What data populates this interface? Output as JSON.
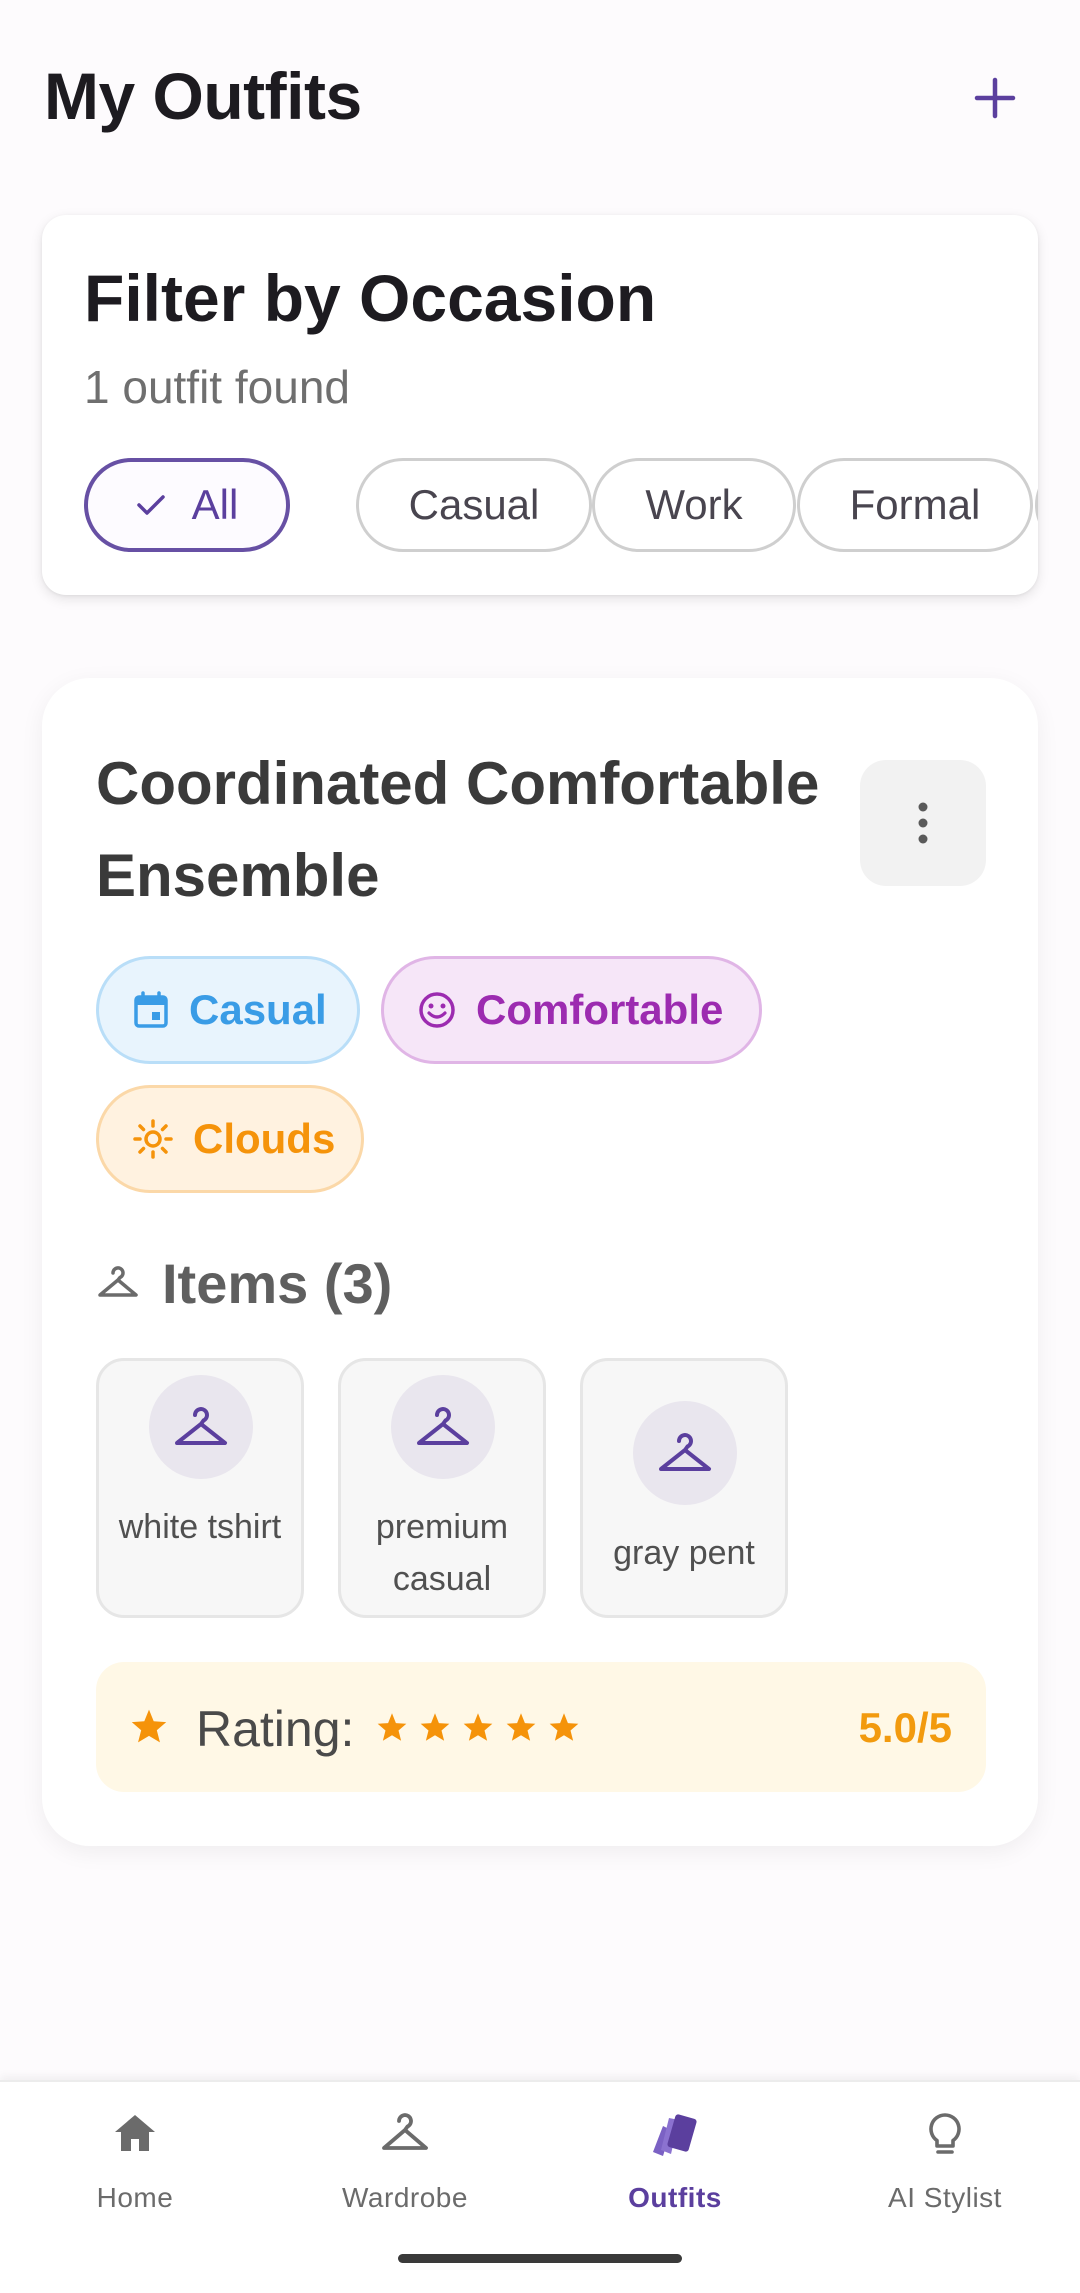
{
  "header": {
    "title": "My Outfits",
    "add_icon": "plus-icon"
  },
  "filter": {
    "title": "Filter by Occasion",
    "count_text": "1 outfit found",
    "chips": [
      {
        "label": "All",
        "selected": true
      },
      {
        "label": "Casual",
        "selected": false
      },
      {
        "label": "Work",
        "selected": false
      },
      {
        "label": "Formal",
        "selected": false
      }
    ]
  },
  "outfit": {
    "title": "Coordinated Comfortable Ensemble",
    "tags": {
      "occasion": {
        "label": "Casual",
        "icon": "calendar-icon",
        "color": "#3a9ce6"
      },
      "mood": {
        "label": "Comfortable",
        "icon": "smile-icon",
        "color": "#9c2bb0"
      },
      "weather": {
        "label": "Clouds",
        "icon": "sun-icon",
        "color": "#f5930a"
      }
    },
    "items_title": "Items (3)",
    "items": [
      {
        "name": "white tshirt",
        "icon": "hanger-icon"
      },
      {
        "name": "premium casual",
        "icon": "hanger-icon"
      },
      {
        "name": "gray pent",
        "icon": "hanger-icon"
      }
    ],
    "rating": {
      "label": "Rating:",
      "stars": 5,
      "value_text": "5.0/5"
    }
  },
  "nav": {
    "items": [
      {
        "label": "Home",
        "icon": "home-icon",
        "active": false
      },
      {
        "label": "Wardrobe",
        "icon": "hanger-icon",
        "active": false
      },
      {
        "label": "Outfits",
        "icon": "outfits-icon",
        "active": true
      },
      {
        "label": "AI Stylist",
        "icon": "lightbulb-icon",
        "active": false
      }
    ]
  },
  "colors": {
    "accent": "#6750a4",
    "rating": "#f29a0e",
    "background": "#fdfbfd"
  }
}
